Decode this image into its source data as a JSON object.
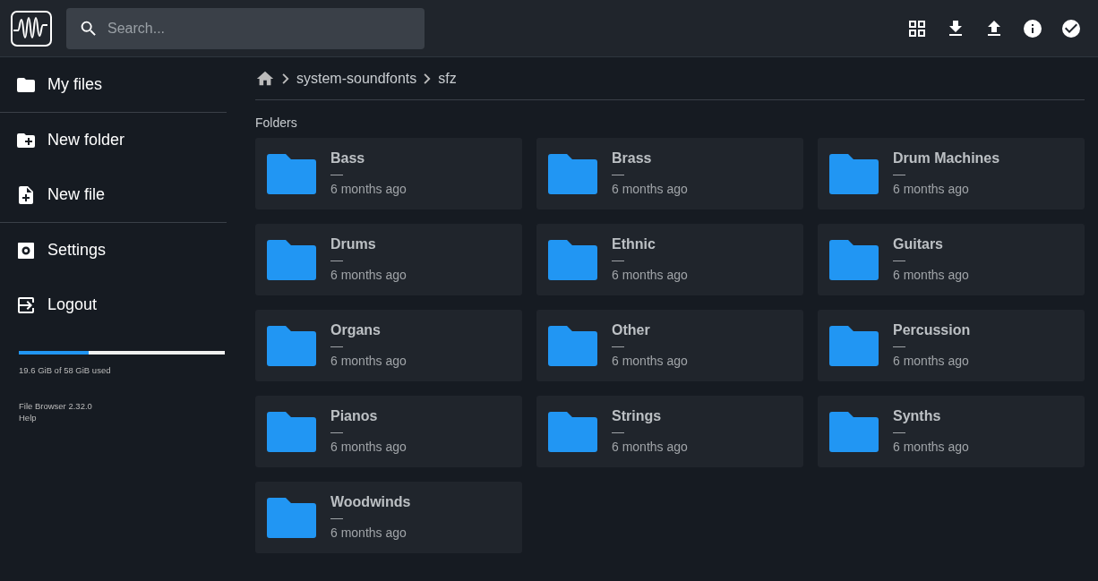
{
  "header": {
    "search": {
      "placeholder": "Search..."
    },
    "actions": [
      {
        "kind": "grid"
      },
      {
        "kind": "download"
      },
      {
        "kind": "upload"
      },
      {
        "kind": "info"
      },
      {
        "kind": "check"
      }
    ]
  },
  "sidebar": {
    "items": [
      {
        "kind": "folder",
        "label": "My files",
        "divider_after": true
      },
      {
        "kind": "new-folder",
        "label": "New folder",
        "divider_after": false
      },
      {
        "kind": "new-file",
        "label": "New file",
        "divider_after": true
      },
      {
        "kind": "settings",
        "label": "Settings",
        "divider_after": false
      },
      {
        "kind": "logout",
        "label": "Logout",
        "divider_after": false
      }
    ],
    "usage": {
      "level": 0.337,
      "text": "19.6 GiB of 58 GiB used"
    },
    "version": "File Browser 2.32.0",
    "help": "Help"
  },
  "breadcrumbs": [
    "system-soundfonts",
    "sfz"
  ],
  "section_title": "Folders",
  "folders": [
    {
      "name": "Bass",
      "size": "—",
      "modified": "6 months ago"
    },
    {
      "name": "Brass",
      "size": "—",
      "modified": "6 months ago"
    },
    {
      "name": "Drum Machines",
      "size": "—",
      "modified": "6 months ago"
    },
    {
      "name": "Drums",
      "size": "—",
      "modified": "6 months ago"
    },
    {
      "name": "Ethnic",
      "size": "—",
      "modified": "6 months ago"
    },
    {
      "name": "Guitars",
      "size": "—",
      "modified": "6 months ago"
    },
    {
      "name": "Organs",
      "size": "—",
      "modified": "6 months ago"
    },
    {
      "name": "Other",
      "size": "—",
      "modified": "6 months ago"
    },
    {
      "name": "Percussion",
      "size": "—",
      "modified": "6 months ago"
    },
    {
      "name": "Pianos",
      "size": "—",
      "modified": "6 months ago"
    },
    {
      "name": "Strings",
      "size": "—",
      "modified": "6 months ago"
    },
    {
      "name": "Synths",
      "size": "—",
      "modified": "6 months ago"
    },
    {
      "name": "Woodwinds",
      "size": "—",
      "modified": "6 months ago"
    }
  ]
}
